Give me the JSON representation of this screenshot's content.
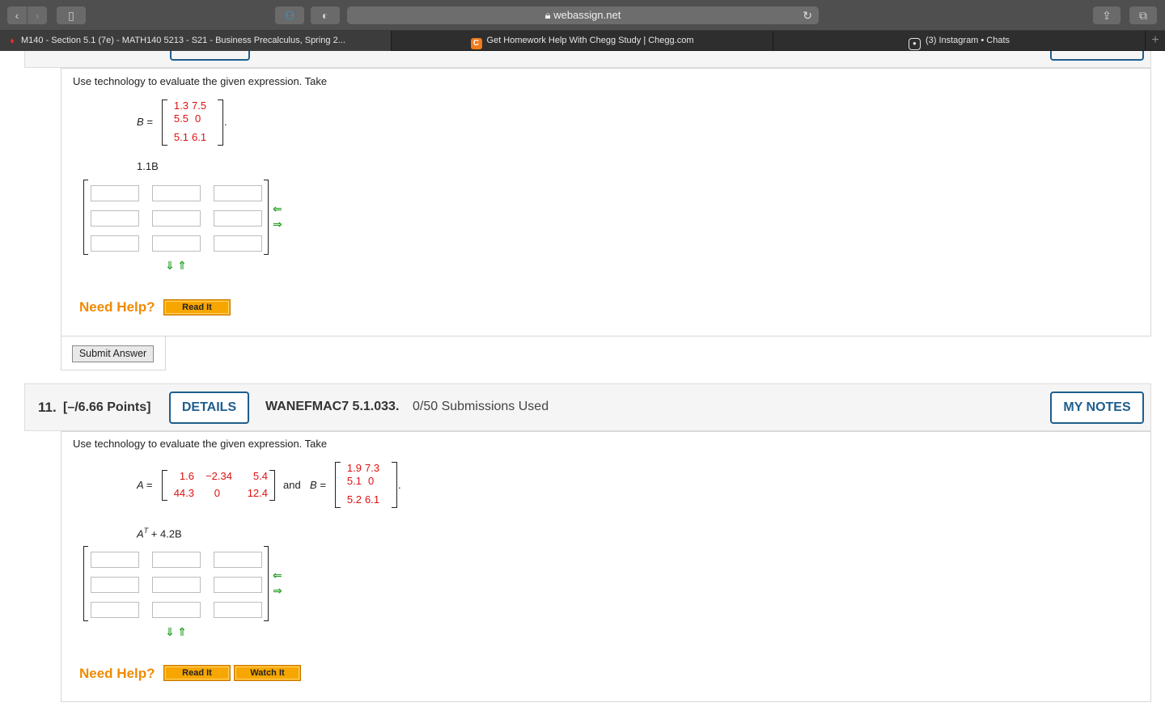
{
  "browser": {
    "url": "webassign.net",
    "tabs": [
      {
        "label": "M140 - Section 5.1 (7e) - MATH140 5213 - S21 - Business Precalculus, Spring 2...",
        "icon": "webassign-icon",
        "active": true
      },
      {
        "label": "Get Homework Help With Chegg Study | Chegg.com",
        "icon": "chegg-icon",
        "icon_letter": "C",
        "active": false
      },
      {
        "label": "(3) Instagram • Chats",
        "icon": "instagram-icon",
        "active": false
      }
    ]
  },
  "question10": {
    "instruction": "Use technology to evaluate the given expression. Take",
    "b_label": "B =",
    "b_matrix": [
      [
        "1.3",
        "7.5"
      ],
      [
        "5.5",
        "0"
      ],
      [
        "5.1",
        "6.1"
      ]
    ],
    "period": ".",
    "expression": "1.1B",
    "answer_grid": {
      "rows": 3,
      "cols": 3,
      "values": [
        "",
        "",
        "",
        "",
        "",
        "",
        "",
        "",
        ""
      ]
    },
    "need_help": "Need Help?",
    "help_buttons": [
      "Read It"
    ],
    "submit_label": "Submit Answer"
  },
  "question11": {
    "number": "11.",
    "points": "[–/6.66 Points]",
    "details_label": "DETAILS",
    "code": "WANEFMAC7 5.1.033.",
    "submissions": "0/50 Submissions Used",
    "notes_label": "MY NOTES",
    "instruction": "Use technology to evaluate the given expression. Take",
    "a_label": "A =",
    "a_matrix": [
      [
        "1.6",
        "−2.34",
        "5.4"
      ],
      [
        "44.3",
        "0",
        "12.4"
      ]
    ],
    "and_text": "and",
    "b_label": "B =",
    "b_matrix": [
      [
        "1.9",
        "7.3"
      ],
      [
        "5.1",
        "0"
      ],
      [
        "5.2",
        "6.1"
      ]
    ],
    "period": ".",
    "expression_base": "A",
    "expression_sup": "T",
    "expression_rest": " + 4.2B",
    "answer_grid": {
      "rows": 3,
      "cols": 3,
      "values": [
        "",
        "",
        "",
        "",
        "",
        "",
        "",
        "",
        ""
      ]
    },
    "need_help": "Need Help?",
    "help_buttons": [
      "Read It",
      "Watch It"
    ]
  },
  "colors": {
    "accent": "#1e5e8c",
    "matrix_value": "#dd1111",
    "help_orange": "#f08a00",
    "help_button": "#f7a600",
    "arrow_green": "#2aa32a"
  }
}
